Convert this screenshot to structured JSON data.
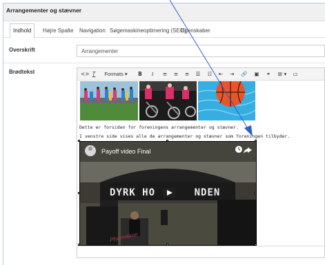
{
  "header": {
    "title": "Arrangementer og stævner"
  },
  "tabs": [
    {
      "label": "Indhold"
    },
    {
      "label": "Højre Spalte"
    },
    {
      "label": "Navigation"
    },
    {
      "label": "Søgemaskineoptimering (SEO)"
    },
    {
      "label": "Egenskaber"
    }
  ],
  "fields": {
    "overskrift_label": "Overskrift",
    "overskrift_value": "Arrangementer",
    "brodtekst_label": "Brødtekst"
  },
  "toolbar": {
    "source": "<>",
    "clear_format": "T",
    "formats": "Formats ▾",
    "bold": "B",
    "italic": "I",
    "table": "⊞ ▾"
  },
  "content": {
    "line1": "Dette er forsiden for foreningens arrangementer og stævner.",
    "line2": "I venstre side vises alle de arrangementer og stævner som foreningen tilbyder."
  },
  "video": {
    "title": "Payoff video Final",
    "banner_text": "DYRK HO      NDEN",
    "shirt_text": "Pharmakon"
  },
  "colors": {
    "accent_arrow": "#2f5fc8",
    "tab_border": "#cccccc"
  }
}
